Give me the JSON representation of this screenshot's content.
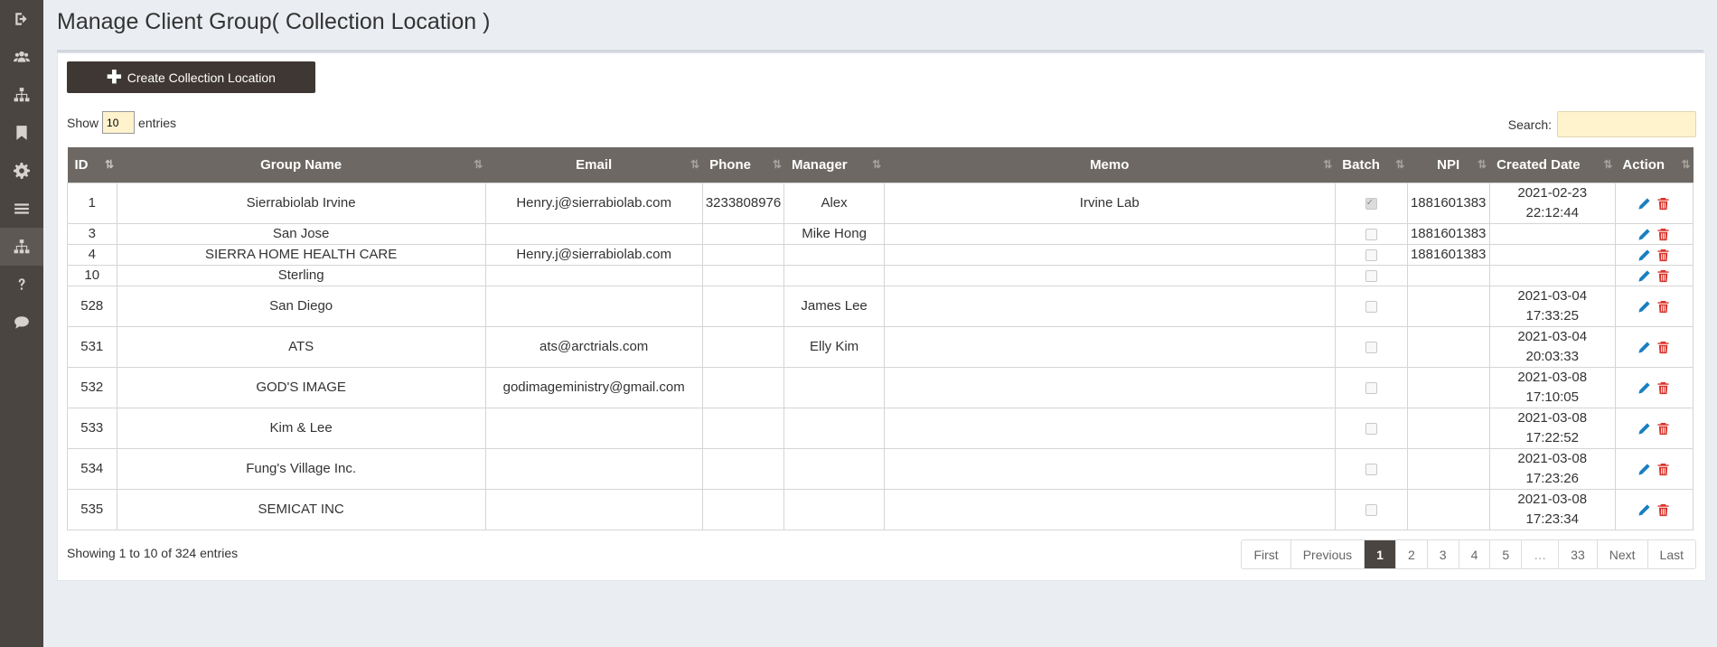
{
  "sidebar": {
    "icons": [
      "sign-out-icon",
      "users-icon",
      "sitemap-icon",
      "bookmark-icon",
      "gear-icon",
      "menu-icon",
      "sitemap-icon",
      "question-icon",
      "comment-icon"
    ],
    "active_index": 6
  },
  "page": {
    "title": "Manage Client Group( Collection Location )"
  },
  "toolbar": {
    "create_label": "Create Collection Location"
  },
  "length": {
    "show": "Show",
    "value": "10",
    "entries": "entries"
  },
  "search": {
    "label": "Search:",
    "value": ""
  },
  "table": {
    "columns": [
      "ID",
      "Group Name",
      "Email",
      "Phone",
      "Manager",
      "Memo",
      "Batch",
      "NPI",
      "Created Date",
      "Action"
    ],
    "rows": [
      {
        "id": "1",
        "group": "Sierrabiolab Irvine",
        "email": "Henry.j@sierrabiolab.com",
        "phone": "3233808976",
        "manager": "Alex",
        "memo": "Irvine Lab",
        "batch": true,
        "npi": "1881601383",
        "date1": "2021-02-23",
        "date2": "22:12:44"
      },
      {
        "id": "3",
        "group": "San Jose",
        "email": "",
        "phone": "",
        "manager": "Mike Hong",
        "memo": "",
        "batch": false,
        "npi": "1881601383",
        "date1": "",
        "date2": ""
      },
      {
        "id": "4",
        "group": "SIERRA HOME HEALTH CARE",
        "email": "Henry.j@sierrabiolab.com",
        "phone": "",
        "manager": "",
        "memo": "",
        "batch": false,
        "npi": "1881601383",
        "date1": "",
        "date2": ""
      },
      {
        "id": "10",
        "group": "Sterling",
        "email": "",
        "phone": "",
        "manager": "",
        "memo": "",
        "batch": false,
        "npi": "",
        "date1": "",
        "date2": ""
      },
      {
        "id": "528",
        "group": "San Diego",
        "email": "",
        "phone": "",
        "manager": "James Lee",
        "memo": "",
        "batch": false,
        "npi": "",
        "date1": "2021-03-04",
        "date2": "17:33:25"
      },
      {
        "id": "531",
        "group": "ATS",
        "email": "ats@arctrials.com",
        "phone": "",
        "manager": "Elly Kim",
        "memo": "",
        "batch": false,
        "npi": "",
        "date1": "2021-03-04",
        "date2": "20:03:33"
      },
      {
        "id": "532",
        "group": "GOD'S IMAGE",
        "email": "godimageministry@gmail.com",
        "phone": "",
        "manager": "",
        "memo": "",
        "batch": false,
        "npi": "",
        "date1": "2021-03-08",
        "date2": "17:10:05"
      },
      {
        "id": "533",
        "group": "Kim & Lee",
        "email": "",
        "phone": "",
        "manager": "",
        "memo": "",
        "batch": false,
        "npi": "",
        "date1": "2021-03-08",
        "date2": "17:22:52"
      },
      {
        "id": "534",
        "group": "Fung's Village Inc.",
        "email": "",
        "phone": "",
        "manager": "",
        "memo": "",
        "batch": false,
        "npi": "",
        "date1": "2021-03-08",
        "date2": "17:23:26"
      },
      {
        "id": "535",
        "group": "SEMICAT INC",
        "email": "",
        "phone": "",
        "manager": "",
        "memo": "",
        "batch": false,
        "npi": "",
        "date1": "2021-03-08",
        "date2": "17:23:34"
      }
    ]
  },
  "info": "Showing 1 to 10 of 324 entries",
  "pagination": [
    "First",
    "Previous",
    "1",
    "2",
    "3",
    "4",
    "5",
    "…",
    "33",
    "Next",
    "Last"
  ],
  "pagination_active": "1",
  "colors": {
    "sidebar": "#4a4541",
    "header": "#6d6863",
    "accent": "#3f3733",
    "edit": "#1a7fc1",
    "delete": "#d9342b"
  }
}
